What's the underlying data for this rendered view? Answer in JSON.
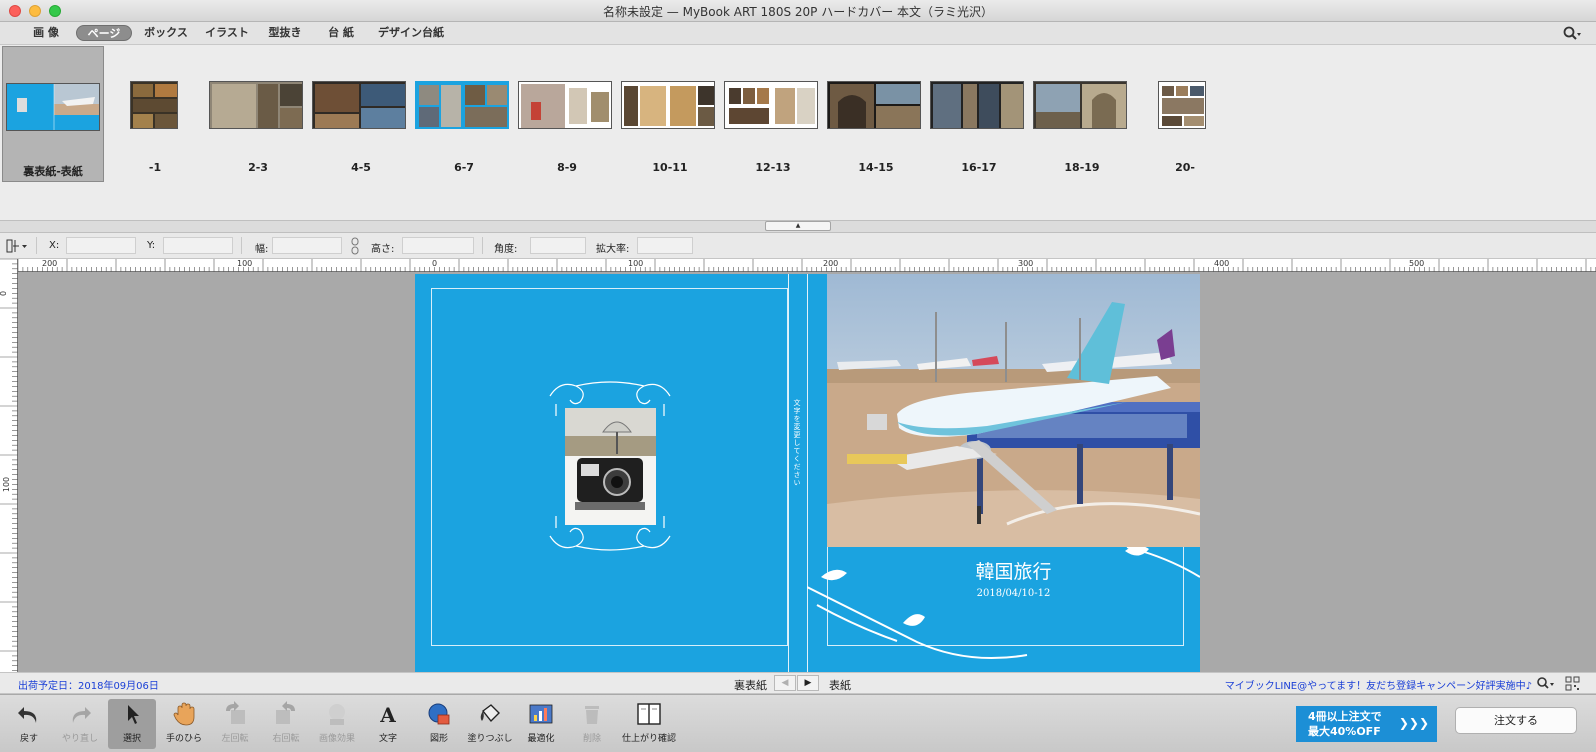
{
  "window": {
    "title": "名称未設定 — MyBook ART 180S 20P ハードカバー 本文（ラミ光沢）"
  },
  "tabs": [
    {
      "label": "画 像",
      "active": false
    },
    {
      "label": "ページ",
      "active": true
    },
    {
      "label": "ボックス",
      "active": false
    },
    {
      "label": "イラスト",
      "active": false
    },
    {
      "label": "型抜き",
      "active": false
    },
    {
      "label": "台 紙",
      "active": false
    },
    {
      "label": "デザイン台紙",
      "active": false
    }
  ],
  "spreads": [
    {
      "label": "裏表紙-表紙",
      "selected": true
    },
    {
      "label": "-1"
    },
    {
      "label": "2-3"
    },
    {
      "label": "4-5"
    },
    {
      "label": "6-7"
    },
    {
      "label": "8-9"
    },
    {
      "label": "10-11"
    },
    {
      "label": "12-13"
    },
    {
      "label": "14-15"
    },
    {
      "label": "16-17"
    },
    {
      "label": "18-19"
    },
    {
      "label": "20-"
    }
  ],
  "properties": {
    "x_label": "X:",
    "y_label": "Y:",
    "width_label": "幅:",
    "height_label": "高さ:",
    "angle_label": "角度:",
    "zoom_label": "拡大率:",
    "x_value": "",
    "y_value": "",
    "width_value": "",
    "height_value": "",
    "angle_value": "",
    "zoom_value": ""
  },
  "ruler": {
    "h_labels": [
      "200",
      "100",
      "0",
      "100",
      "200",
      "300",
      "400",
      "500"
    ],
    "v_labels": [
      "0",
      "100"
    ]
  },
  "cover": {
    "title": "韓国旅行",
    "date": "2018/04/10-12",
    "spine_text": "文字を変更してください"
  },
  "status": {
    "ship_date": "出荷予定日：2018年09月06日",
    "nav_left": "裏表紙",
    "nav_right": "表紙",
    "promo": "マイブックLINE@やってます！友だち登録キャンペーン好評実施中♪"
  },
  "tools": [
    {
      "label": "戻す",
      "icon": "undo-icon",
      "enabled": true
    },
    {
      "label": "やり直し",
      "icon": "redo-icon",
      "enabled": false
    },
    {
      "label": "選択",
      "icon": "pointer-icon",
      "enabled": true,
      "active": true
    },
    {
      "label": "手のひら",
      "icon": "hand-icon",
      "enabled": true
    },
    {
      "label": "左回転",
      "icon": "rotate-left-icon",
      "enabled": false
    },
    {
      "label": "右回転",
      "icon": "rotate-right-icon",
      "enabled": false
    },
    {
      "label": "画像効果",
      "icon": "image-effect-icon",
      "enabled": false
    },
    {
      "label": "文字",
      "icon": "text-icon",
      "enabled": true
    },
    {
      "label": "図形",
      "icon": "shape-icon",
      "enabled": true
    },
    {
      "label": "塗りつぶし",
      "icon": "paint-bucket-icon",
      "enabled": true
    },
    {
      "label": "最適化",
      "icon": "optimize-icon",
      "enabled": true
    },
    {
      "label": "削除",
      "icon": "delete-icon",
      "enabled": false
    },
    {
      "label": "仕上がり確認",
      "icon": "preview-book-icon",
      "enabled": true
    }
  ],
  "order": {
    "banner_line1": "4冊以上注文で",
    "banner_line2": "最大40%OFF",
    "button_label": "注文する"
  },
  "colors": {
    "page_blue": "#1ba3e0",
    "link_blue": "#1a3fd6",
    "banner_blue": "#1c8fd6"
  }
}
